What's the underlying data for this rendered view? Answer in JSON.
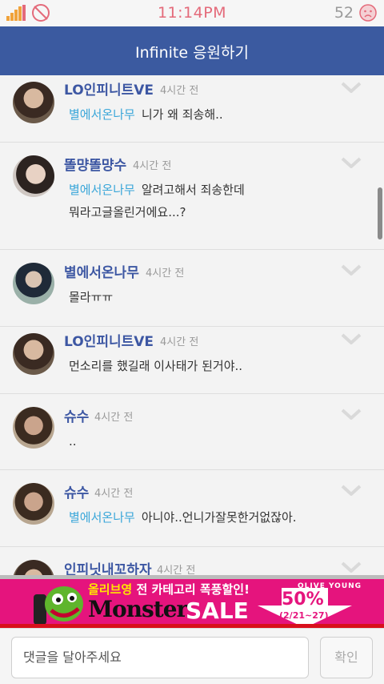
{
  "status_bar": {
    "time": "11:14PM",
    "battery": "52"
  },
  "header": {
    "title": "Infinite 응원하기"
  },
  "comments": [
    {
      "user": "LO인피니트VE",
      "time": "4시간 전",
      "reply_to": "별에서온나무",
      "text": "니가 왜 죄송해..",
      "text2": ""
    },
    {
      "user": "똘먕똘먕수",
      "time": "4시간 전",
      "reply_to": "별에서온나무",
      "text": "알려고해서 죄송한데",
      "text2": "뭐라고글올린거에요...?"
    },
    {
      "user": "별에서온나무",
      "time": "4시간 전",
      "reply_to": "",
      "text": "몰라ㅠㅠ",
      "text2": ""
    },
    {
      "user": "LO인피니트VE",
      "time": "4시간 전",
      "reply_to": "",
      "text": "먼소리를 했길래 이사태가 된거야..",
      "text2": ""
    },
    {
      "user": "슈수",
      "time": "4시간 전",
      "reply_to": "",
      "text": "..",
      "text2": ""
    },
    {
      "user": "슈수",
      "time": "4시간 전",
      "reply_to": "별에서온나무",
      "text": "아니야..언니가잘못한거없잖아.",
      "text2": ""
    },
    {
      "user": "인피닛내꼬하자",
      "time": "4시간 전",
      "reply_to": "",
      "text": "",
      "text2": ""
    }
  ],
  "ad": {
    "headline_brand": "올리브영",
    "headline_rest": "전 카테고리 폭풍할인!",
    "monster": "Monster",
    "sale": "SALE",
    "brand": "OLIVE YOUNG",
    "percent": "50%",
    "dates": "(2/21~27)"
  },
  "input": {
    "placeholder": "댓글을 달아주세요",
    "confirm_label": "확인"
  },
  "colors": {
    "header": "#3b5aa0",
    "username": "#3d57a3",
    "reply": "#39a6d9",
    "ad_bg": "#e5147d"
  }
}
